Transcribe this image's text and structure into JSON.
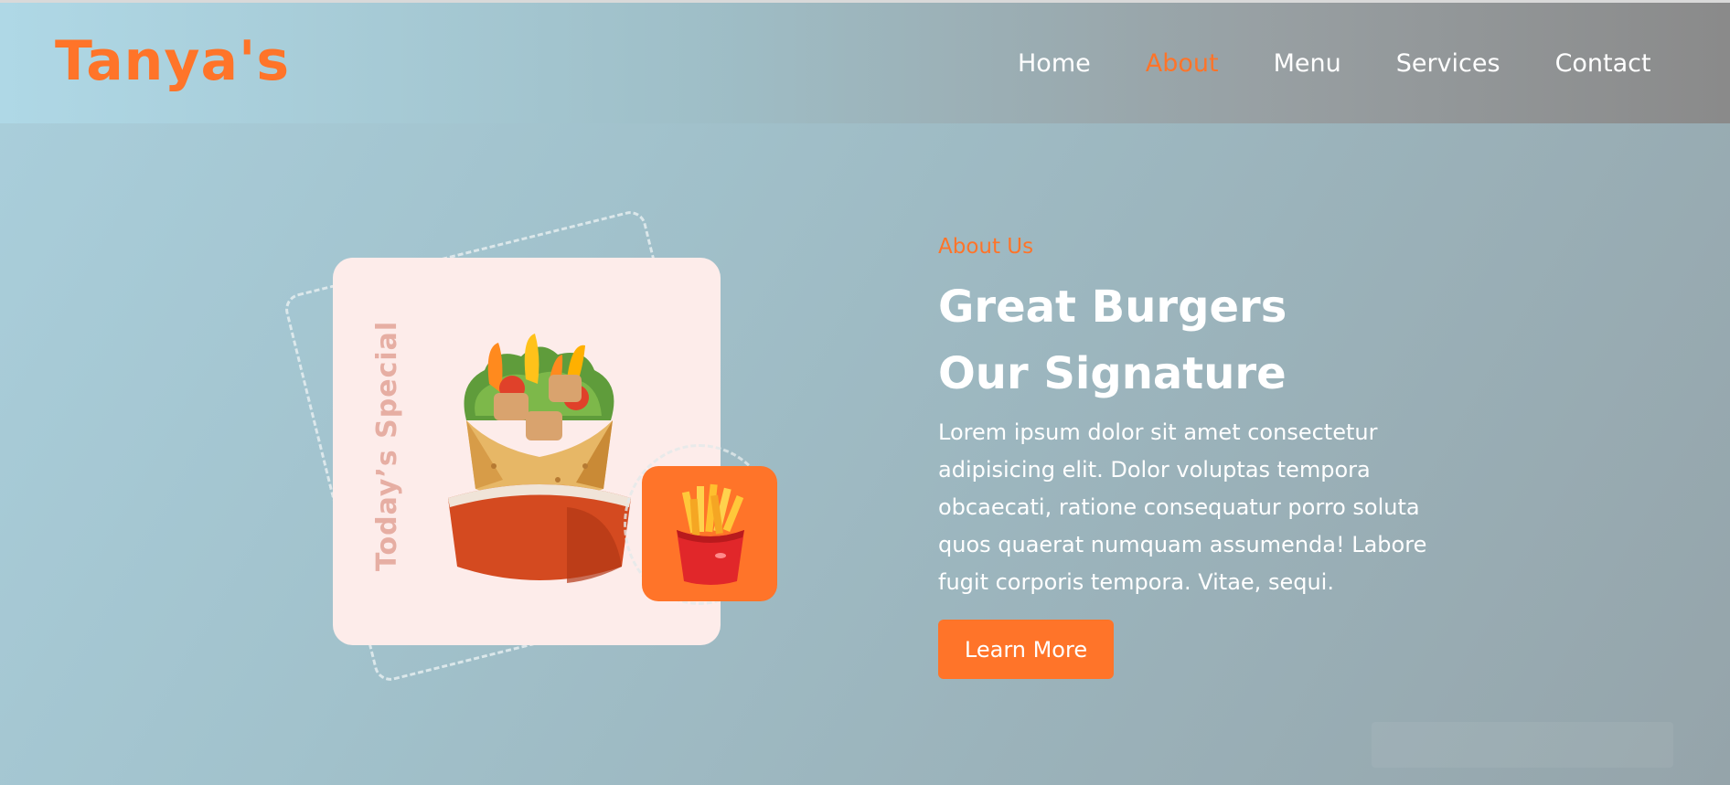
{
  "brand": {
    "logo_text": "Tanya's"
  },
  "nav": {
    "items": [
      {
        "label": "Home",
        "active": false
      },
      {
        "label": "About",
        "active": true
      },
      {
        "label": "Menu",
        "active": false
      },
      {
        "label": "Services",
        "active": false
      },
      {
        "label": "Contact",
        "active": false
      }
    ]
  },
  "hero_image": {
    "badge_text": "Today’s Special",
    "main_icon": "wrap-burrito-icon",
    "side_icon": "french-fries-icon"
  },
  "about": {
    "eyebrow": "About Us",
    "headline_lines": [
      "Great Burgers",
      "Our Signature"
    ],
    "paragraph_lines": [
      "Lorem ipsum dolor sit amet consectetur",
      "adipisicing elit. Dolor voluptas tempora",
      "obcaecati, ratione consequatur porro soluta",
      "quos quaerat numquam assumenda! Labore",
      "fugit corporis tempora. Vitae, sequi."
    ],
    "button_label": "Learn More"
  },
  "colors": {
    "accent": "#ff7429",
    "text_light": "#ffffff",
    "card_bg": "#fdecea",
    "badge_text": "#e6aea3"
  }
}
